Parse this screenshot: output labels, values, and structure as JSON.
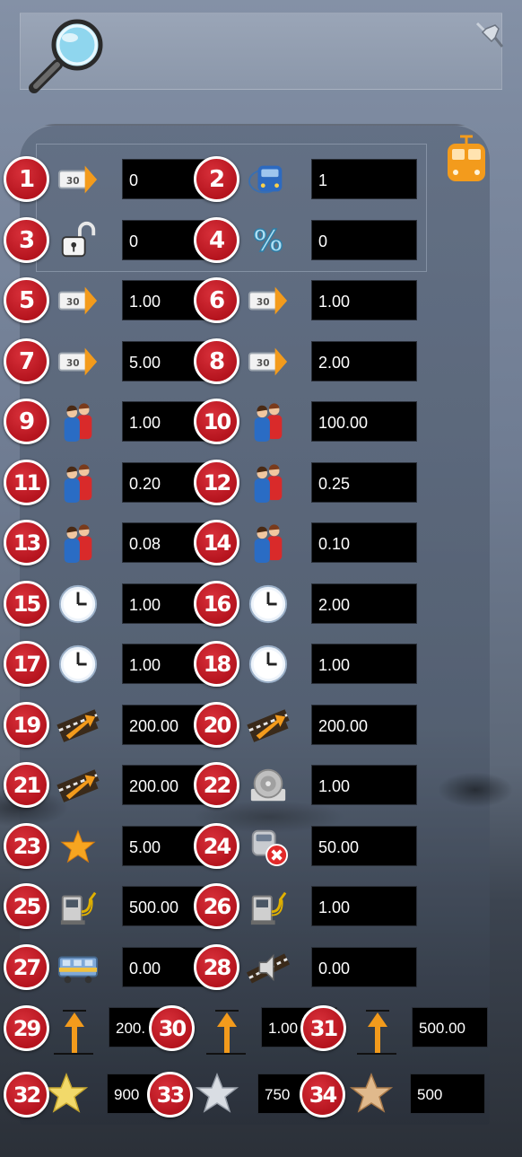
{
  "colors": {
    "badge": "#c21c26",
    "field_bg": "#000000",
    "field_text": "#ffffff",
    "accent_orange": "#f0a020"
  },
  "header": {
    "icons": [
      "magnifier-icon",
      "pin-icon"
    ]
  },
  "panel": {
    "icon": "train-icon"
  },
  "rows": [
    {
      "left": {
        "num": "1",
        "icon": "speed-sign-icon",
        "value": "0"
      },
      "right": {
        "num": "2",
        "icon": "train-front-icon",
        "value": "1"
      }
    },
    {
      "left": {
        "num": "3",
        "icon": "lock-open-icon",
        "value": "0"
      },
      "right": {
        "num": "4",
        "icon": "percent-icon",
        "value": "0"
      }
    },
    {
      "left": {
        "num": "5",
        "icon": "speed-sign-icon",
        "value": "1.00"
      },
      "right": {
        "num": "6",
        "icon": "speed-sign-icon",
        "value": "1.00"
      }
    },
    {
      "left": {
        "num": "7",
        "icon": "speed-sign-icon",
        "value": "5.00"
      },
      "right": {
        "num": "8",
        "icon": "speed-sign-icon",
        "value": "2.00"
      }
    },
    {
      "left": {
        "num": "9",
        "icon": "passengers-icon",
        "value": "1.00"
      },
      "right": {
        "num": "10",
        "icon": "passengers-icon",
        "value": "100.00"
      }
    },
    {
      "left": {
        "num": "11",
        "icon": "passengers-icon",
        "value": "0.20"
      },
      "right": {
        "num": "12",
        "icon": "passengers-icon",
        "value": "0.25"
      }
    },
    {
      "left": {
        "num": "13",
        "icon": "passengers-icon",
        "value": "0.08"
      },
      "right": {
        "num": "14",
        "icon": "passengers-icon",
        "value": "0.10"
      }
    },
    {
      "left": {
        "num": "15",
        "icon": "clock-icon",
        "value": "1.00"
      },
      "right": {
        "num": "16",
        "icon": "clock-icon",
        "value": "2.00"
      }
    },
    {
      "left": {
        "num": "17",
        "icon": "clock-icon",
        "value": "1.00"
      },
      "right": {
        "num": "18",
        "icon": "clock-icon",
        "value": "1.00"
      }
    },
    {
      "left": {
        "num": "19",
        "icon": "track-arrow-icon",
        "value": "200.00"
      },
      "right": {
        "num": "20",
        "icon": "track-arrow-icon",
        "value": "200.00"
      }
    },
    {
      "left": {
        "num": "21",
        "icon": "track-arrow-icon",
        "value": "200.00"
      },
      "right": {
        "num": "22",
        "icon": "speaker-icon",
        "value": "1.00"
      }
    },
    {
      "left": {
        "num": "23",
        "icon": "star-icon",
        "value": "5.00"
      },
      "right": {
        "num": "24",
        "icon": "train-remove-icon",
        "value": "50.00"
      }
    },
    {
      "left": {
        "num": "25",
        "icon": "fuel-pump-icon",
        "value": "500.00"
      },
      "right": {
        "num": "26",
        "icon": "fuel-pump-icon",
        "value": "1.00"
      }
    },
    {
      "left": {
        "num": "27",
        "icon": "wagon-icon",
        "value": "0.00"
      },
      "right": {
        "num": "28",
        "icon": "track-sound-icon",
        "value": "0.00"
      }
    }
  ],
  "triple_row": [
    {
      "num": "29",
      "icon": "height-arrow-icon",
      "value": "200."
    },
    {
      "num": "30",
      "icon": "height-arrow-icon",
      "value": "1.00"
    },
    {
      "num": "31",
      "icon": "height-arrow-icon",
      "value": "500.00"
    }
  ],
  "star_row": [
    {
      "num": "32",
      "icon": "gold-star-icon",
      "value": "900"
    },
    {
      "num": "33",
      "icon": "silver-star-icon",
      "value": "750"
    },
    {
      "num": "34",
      "icon": "bronze-star-icon",
      "value": "500"
    }
  ]
}
